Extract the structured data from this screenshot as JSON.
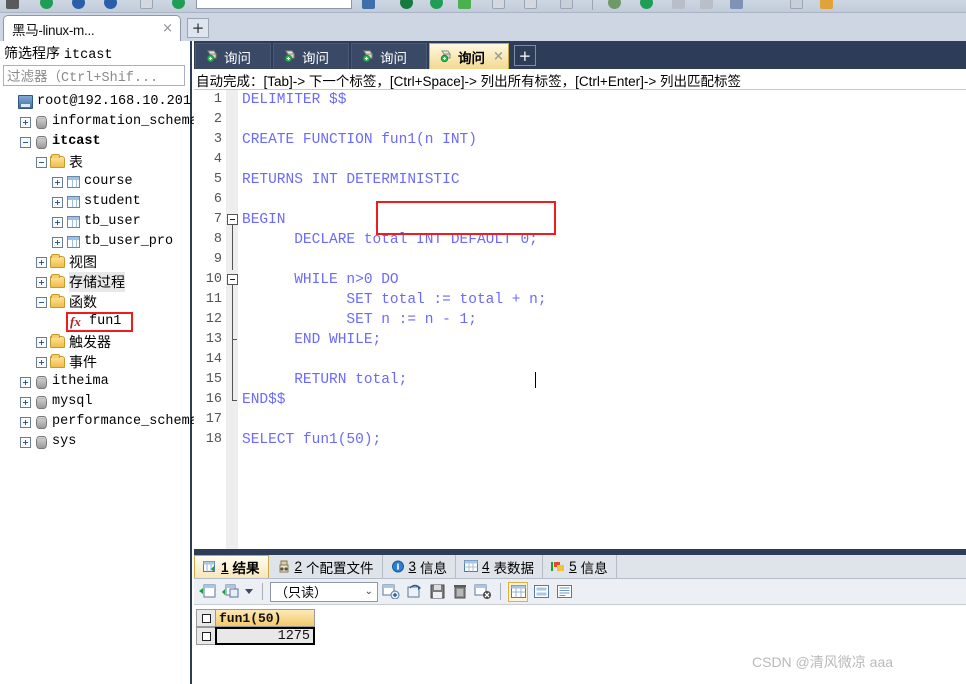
{
  "window_tab": {
    "title": "黑马-linux-m...",
    "close_label": "×",
    "new_tab_label": "+"
  },
  "sidebar": {
    "filter_header_prefix": "筛选程序",
    "filter_header_value": "itcast",
    "filter_placeholder": "过滤器（Ctrl+Shif...",
    "tree": [
      {
        "label": "root@192.168.10.201",
        "icon": "server-icon",
        "indent": 0,
        "expander": "none",
        "bold": false,
        "selected": false
      },
      {
        "label": "information_schema",
        "icon": "database-icon",
        "indent": 1,
        "expander": "plus",
        "bold": false,
        "selected": false
      },
      {
        "label": "itcast",
        "icon": "database-icon",
        "indent": 1,
        "expander": "minus",
        "bold": true,
        "selected": false
      },
      {
        "label": "表",
        "icon": "folder-icon",
        "indent": 2,
        "expander": "minus",
        "bold": false,
        "selected": false,
        "zh": true
      },
      {
        "label": "course",
        "icon": "table-icon",
        "indent": 3,
        "expander": "plus",
        "bold": false,
        "selected": false
      },
      {
        "label": "student",
        "icon": "table-icon",
        "indent": 3,
        "expander": "plus",
        "bold": false,
        "selected": false
      },
      {
        "label": "tb_user",
        "icon": "table-icon",
        "indent": 3,
        "expander": "plus",
        "bold": false,
        "selected": false
      },
      {
        "label": "tb_user_pro",
        "icon": "table-icon",
        "indent": 3,
        "expander": "plus",
        "bold": false,
        "selected": false
      },
      {
        "label": "视图",
        "icon": "folder-icon",
        "indent": 2,
        "expander": "plus",
        "bold": false,
        "selected": false,
        "zh": true
      },
      {
        "label": "存储过程",
        "icon": "folder-icon",
        "indent": 2,
        "expander": "plus",
        "bold": false,
        "selected": true,
        "zh": true
      },
      {
        "label": "函数",
        "icon": "folder-icon",
        "indent": 2,
        "expander": "minus",
        "bold": false,
        "selected": false,
        "zh": true
      },
      {
        "label": "fun1",
        "icon": "function-icon",
        "indent": 3,
        "expander": "none",
        "bold": false,
        "selected": false,
        "highlight": true
      },
      {
        "label": "触发器",
        "icon": "folder-icon",
        "indent": 2,
        "expander": "plus",
        "bold": false,
        "selected": false,
        "zh": true
      },
      {
        "label": "事件",
        "icon": "folder-icon",
        "indent": 2,
        "expander": "plus",
        "bold": false,
        "selected": false,
        "zh": true
      },
      {
        "label": "itheima",
        "icon": "database-icon",
        "indent": 1,
        "expander": "plus",
        "bold": false,
        "selected": false
      },
      {
        "label": "mysql",
        "icon": "database-icon",
        "indent": 1,
        "expander": "plus",
        "bold": false,
        "selected": false
      },
      {
        "label": "performance_schema",
        "icon": "database-icon",
        "indent": 1,
        "expander": "plus",
        "bold": false,
        "selected": false
      },
      {
        "label": "sys",
        "icon": "database-icon",
        "indent": 1,
        "expander": "plus",
        "bold": false,
        "selected": false
      }
    ]
  },
  "editor": {
    "tabs": [
      {
        "label": "询问",
        "active": false
      },
      {
        "label": "询问",
        "active": false
      },
      {
        "label": "询问",
        "active": false
      },
      {
        "label": "询问",
        "active": true
      }
    ],
    "tab_close_label": "×",
    "new_tab_label": "+",
    "autocomplete_hint": "自动完成：[Tab]-> 下一个标签，[Ctrl+Space]-> 列出所有标签，[Ctrl+Enter]-> 列出匹配标签",
    "lines": [
      {
        "n": "1",
        "text": "DELIMITER $$",
        "kw_end": 9
      },
      {
        "n": "2",
        "text": ""
      },
      {
        "n": "3",
        "text": "CREATE FUNCTION fun1(n INT)",
        "kw_end": 15
      },
      {
        "n": "4",
        "text": ""
      },
      {
        "n": "5",
        "text": "RETURNS INT DETERMINISTIC",
        "kw_end": 25
      },
      {
        "n": "6",
        "text": ""
      },
      {
        "n": "7",
        "text": "BEGIN",
        "kw_end": 5
      },
      {
        "n": "8",
        "text": "      DECLARE total INT DEFAULT 0;",
        "kw_end": 33
      },
      {
        "n": "9",
        "text": ""
      },
      {
        "n": "10",
        "text": "      WHILE n>0 DO",
        "kw_end": 18
      },
      {
        "n": "11",
        "text": "            SET total := total + n;",
        "kw_end": 35
      },
      {
        "n": "12",
        "text": "            SET n := n - 1;",
        "kw_end": 27
      },
      {
        "n": "13",
        "text": "      END WHILE;",
        "kw_end": 17
      },
      {
        "n": "14",
        "text": ""
      },
      {
        "n": "15",
        "text": "      RETURN total;",
        "kw_end": 19
      },
      {
        "n": "16",
        "text": "END$$",
        "kw_end": 5
      },
      {
        "n": "17",
        "text": ""
      },
      {
        "n": "18",
        "text": "SELECT fun1(50);",
        "kw_end": 6
      }
    ],
    "highlight_word": "DETERMINISTIC"
  },
  "results": {
    "tabs": [
      {
        "num": "1",
        "label": "结果",
        "icon": "result-grid-icon",
        "active": true
      },
      {
        "num": "2",
        "label": "个配置文件",
        "icon": "profile-icon",
        "active": false
      },
      {
        "num": "3",
        "label": "信息",
        "icon": "info-icon",
        "active": false
      },
      {
        "num": "4",
        "label": "表数据",
        "icon": "table-data-icon",
        "active": false
      },
      {
        "num": "5",
        "label": "信息",
        "icon": "status-icon",
        "active": false
      }
    ],
    "toolbar": {
      "mode_select_value": "（只读）",
      "buttons": [
        "import-grid-icon",
        "export-grid-icon",
        "dropdown-caret-icon",
        "add-row-icon",
        "duplicate-row-icon",
        "save-icon",
        "delete-row-icon",
        "revert-icon",
        "grid-view-icon",
        "form-view-icon",
        "text-view-icon"
      ]
    },
    "grid": {
      "columns": [
        "fun1(50)"
      ],
      "rows": [
        [
          "1275"
        ]
      ]
    }
  },
  "watermark": "CSDN @清风微凉 aaa",
  "colors": {
    "tabbar_dark": "#2e3d57",
    "active_tab_gold": "#f3d98f",
    "keyword_blue": "#6a6aff",
    "highlight_red": "#ee1c1c",
    "grid_header_gold": "#f3c96a"
  }
}
